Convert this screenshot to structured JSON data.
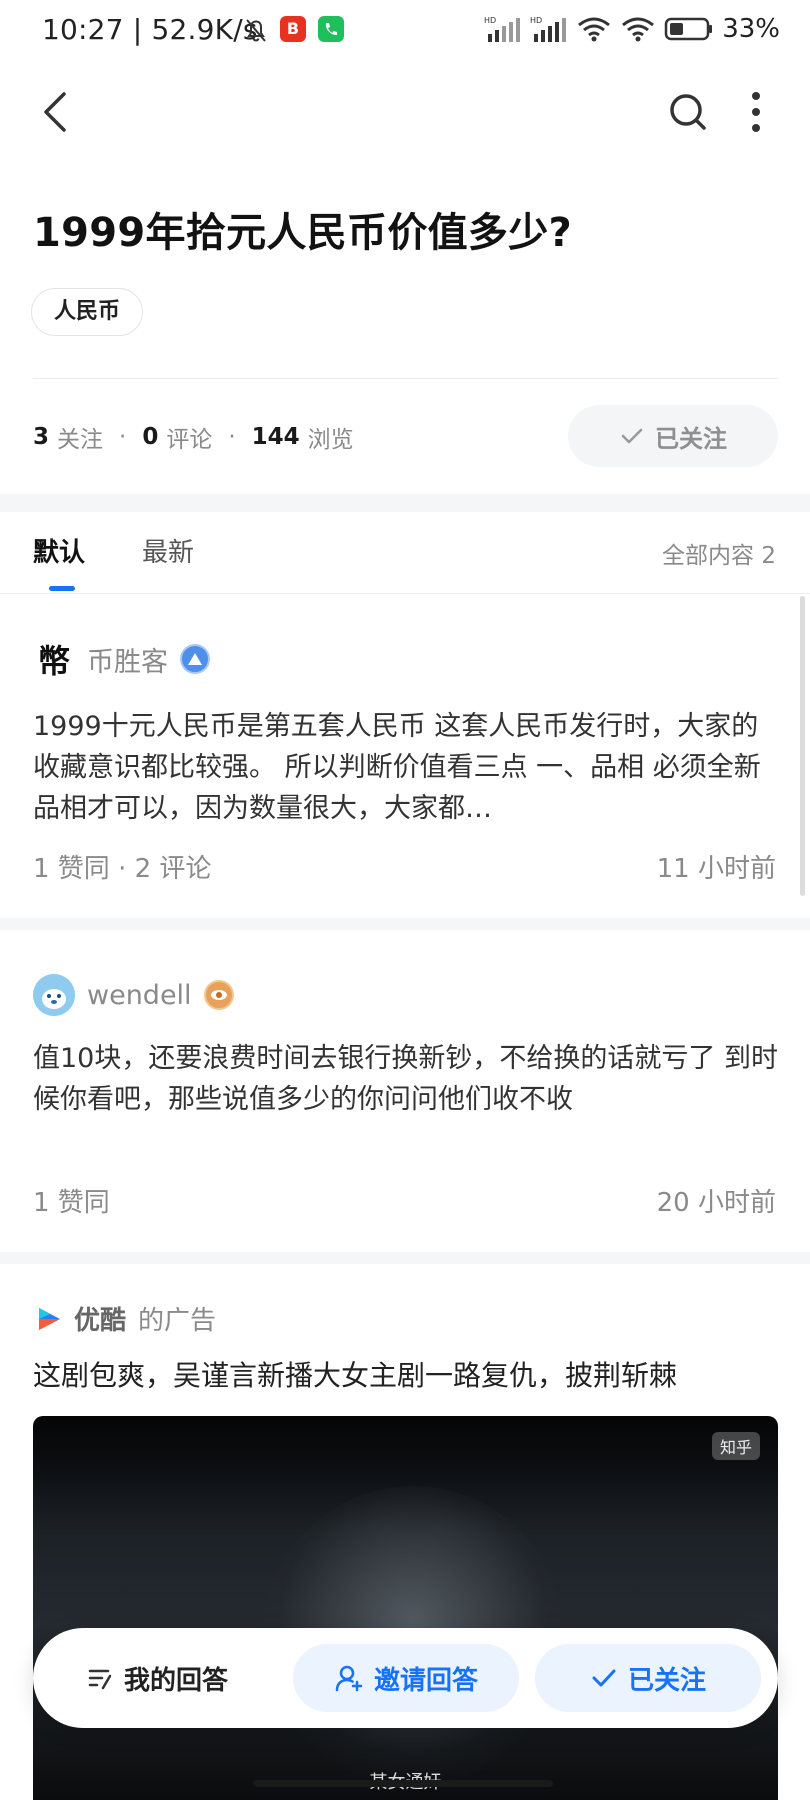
{
  "status_bar": {
    "time_speed": "10:27 | 52.9K/s",
    "battery": "33%"
  },
  "question": {
    "title": "1999年拾元人民币价值多少?",
    "topic": "人民币",
    "stats": {
      "follow_count": "3",
      "follow_label": "关注",
      "comment_count": "0",
      "comment_label": "评论",
      "view_count": "144",
      "view_label": "浏览",
      "separator": "·"
    },
    "follow_button": "已关注"
  },
  "tabs": {
    "default": "默认",
    "latest": "最新",
    "all_count": "全部内容 2"
  },
  "answers": [
    {
      "avatar_char": "幣",
      "author": "币胜客",
      "text": "1999十元人民币是第五套人民币 这套人民币发行时，大家的收藏意识都比较强。 所以判断价值看三点 一、品相 必须全新品相才可以，因为数量很大，大家都…",
      "meta": "1  赞同 · 2  评论",
      "time": "11 小时前"
    },
    {
      "author": "wendell",
      "text": "值10块，还要浪费时间去银行换新钞，不给换的话就亏了 到时候你看吧，那些说值多少的你问问他们收不收",
      "meta": "1  赞同",
      "time": "20 小时前"
    }
  ],
  "ad": {
    "brand": "优酷",
    "suffix": "的广告",
    "title": "这剧包爽，吴谨言新播大女主剧一路复仇，披荆斩棘",
    "watermark": "知乎",
    "subtitle": "某女通奸"
  },
  "action_bar": {
    "my_answer": "我的回答",
    "invite": "邀请回答",
    "followed": "已关注"
  },
  "colors": {
    "accent": "#1772f6",
    "accent_bg": "#ebf3fe",
    "muted": "#8a8a8a"
  }
}
